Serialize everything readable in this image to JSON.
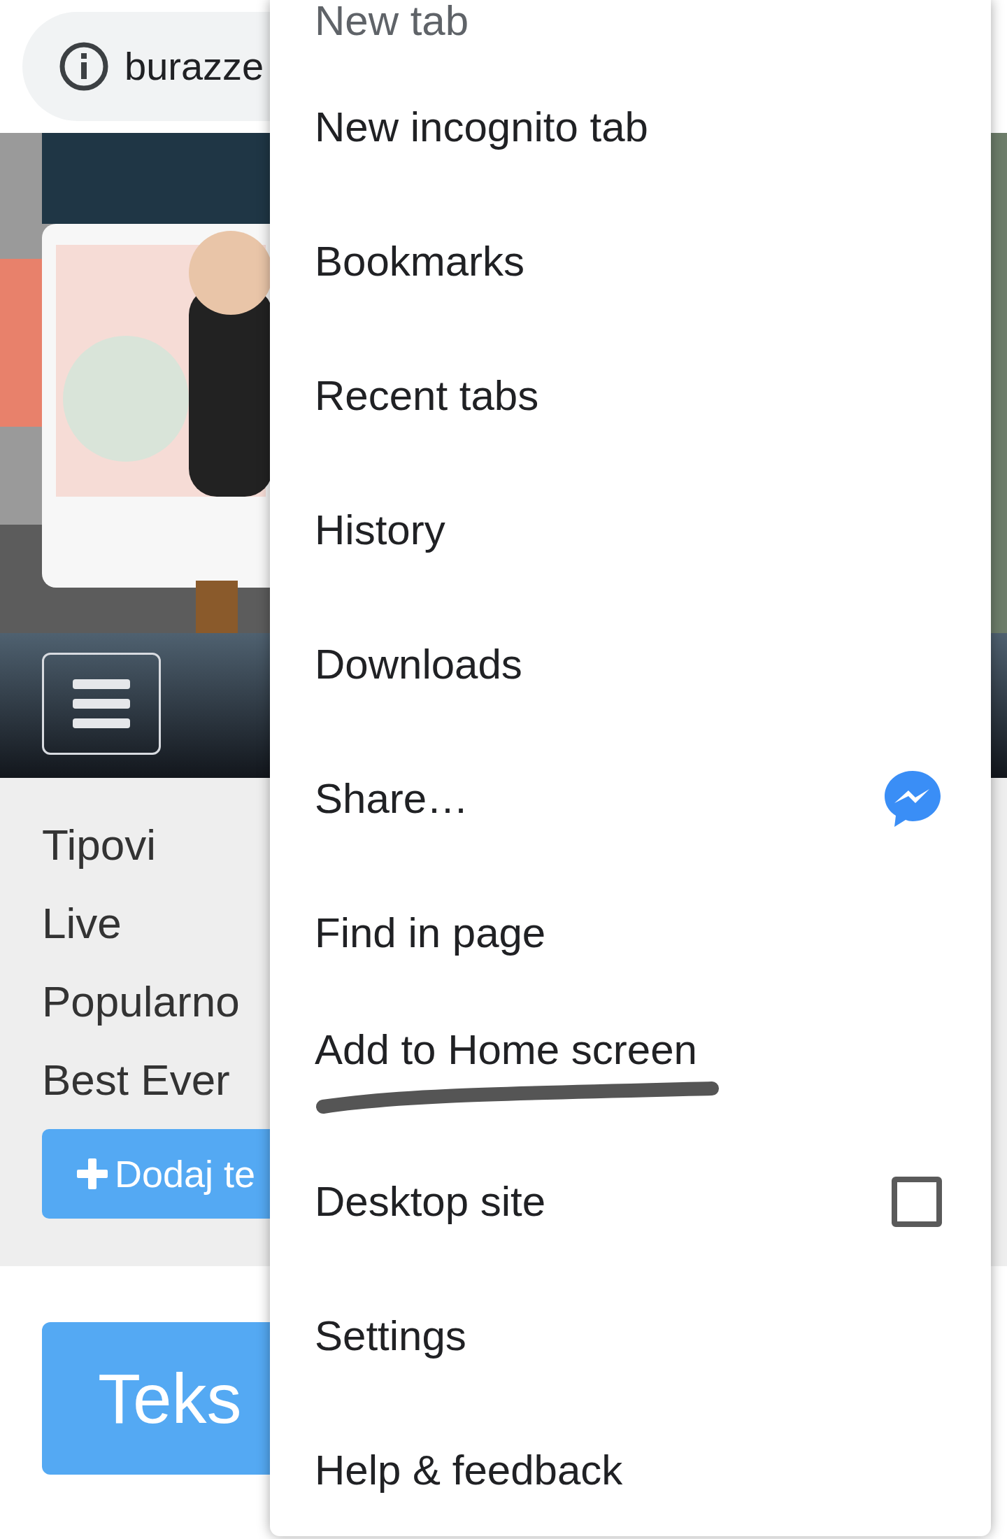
{
  "address_bar": {
    "url": "burazze"
  },
  "site": {
    "nav_links": [
      "Tipovi",
      "Live",
      "Popularno",
      "Best Ever"
    ],
    "add_button": "Dodaj te",
    "text_button": "Teks"
  },
  "menu": {
    "items": [
      {
        "label": "New tab",
        "kind": "plain"
      },
      {
        "label": "New incognito tab",
        "kind": "plain"
      },
      {
        "label": "Bookmarks",
        "kind": "plain"
      },
      {
        "label": "Recent tabs",
        "kind": "plain"
      },
      {
        "label": "History",
        "kind": "plain"
      },
      {
        "label": "Downloads",
        "kind": "plain"
      },
      {
        "label": "Share…",
        "kind": "share"
      },
      {
        "label": "Find in page",
        "kind": "plain"
      },
      {
        "label": "Add to Home screen",
        "kind": "scribbled"
      },
      {
        "label": "Desktop site",
        "kind": "checkbox",
        "checked": false
      },
      {
        "label": "Settings",
        "kind": "plain"
      },
      {
        "label": "Help & feedback",
        "kind": "plain"
      }
    ]
  }
}
